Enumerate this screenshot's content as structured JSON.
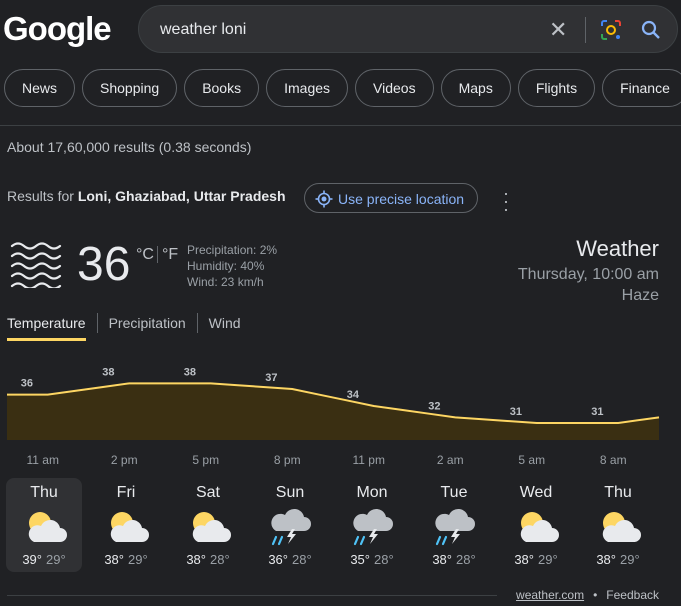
{
  "logo": {
    "text": "Google"
  },
  "search": {
    "query": "weather loni",
    "clear_icon": "close-icon",
    "lens_icon": "lens-icon",
    "search_icon": "search-icon"
  },
  "chips": [
    "News",
    "Shopping",
    "Books",
    "Images",
    "Videos",
    "Maps",
    "Flights",
    "Finance"
  ],
  "stats": "About 17,60,000 results (0.38 seconds)",
  "location": {
    "prefix": "Results for ",
    "place": "Loni, Ghaziabad, Uttar Pradesh",
    "precise_label": "Use precise location"
  },
  "current": {
    "temp": "36",
    "unit_c": "°C",
    "unit_f": "°F",
    "precipitation": "Precipitation: 2%",
    "humidity": "Humidity: 40%",
    "wind": "Wind: 23 km/h",
    "heading": "Weather",
    "datetime": "Thursday, 10:00 am",
    "condition": "Haze",
    "icon": "haze-icon"
  },
  "tabs": [
    "Temperature",
    "Precipitation",
    "Wind"
  ],
  "colors": {
    "accent": "#fdd663",
    "link": "#8ab4f8",
    "bg": "#202124",
    "fill": "#3a2f12"
  },
  "chart_data": {
    "type": "area",
    "x": [
      "11 am",
      "2 pm",
      "5 pm",
      "8 pm",
      "11 pm",
      "2 am",
      "5 am",
      "8 am"
    ],
    "series": [
      {
        "values": [
          36,
          38,
          38,
          37,
          34,
          32,
          31,
          31
        ]
      }
    ],
    "data_labels": [
      "36",
      "38",
      "38",
      "37",
      "34",
      "32",
      "31",
      "31"
    ]
  },
  "forecast": [
    {
      "day": "Thu",
      "hi": "39°",
      "lo": "29°",
      "icon": "partly-cloudy-icon"
    },
    {
      "day": "Fri",
      "hi": "38°",
      "lo": "29°",
      "icon": "partly-cloudy-icon"
    },
    {
      "day": "Sat",
      "hi": "38°",
      "lo": "28°",
      "icon": "partly-cloudy-icon"
    },
    {
      "day": "Sun",
      "hi": "36°",
      "lo": "28°",
      "icon": "thunderstorm-icon"
    },
    {
      "day": "Mon",
      "hi": "35°",
      "lo": "28°",
      "icon": "thunderstorm-icon"
    },
    {
      "day": "Tue",
      "hi": "38°",
      "lo": "28°",
      "icon": "thunderstorm-icon"
    },
    {
      "day": "Wed",
      "hi": "38°",
      "lo": "29°",
      "icon": "partly-cloudy-icon"
    },
    {
      "day": "Thu",
      "hi": "38°",
      "lo": "29°",
      "icon": "partly-cloudy-icon"
    }
  ],
  "footer": {
    "source": "weather.com",
    "separator": "•",
    "feedback": "Feedback"
  }
}
